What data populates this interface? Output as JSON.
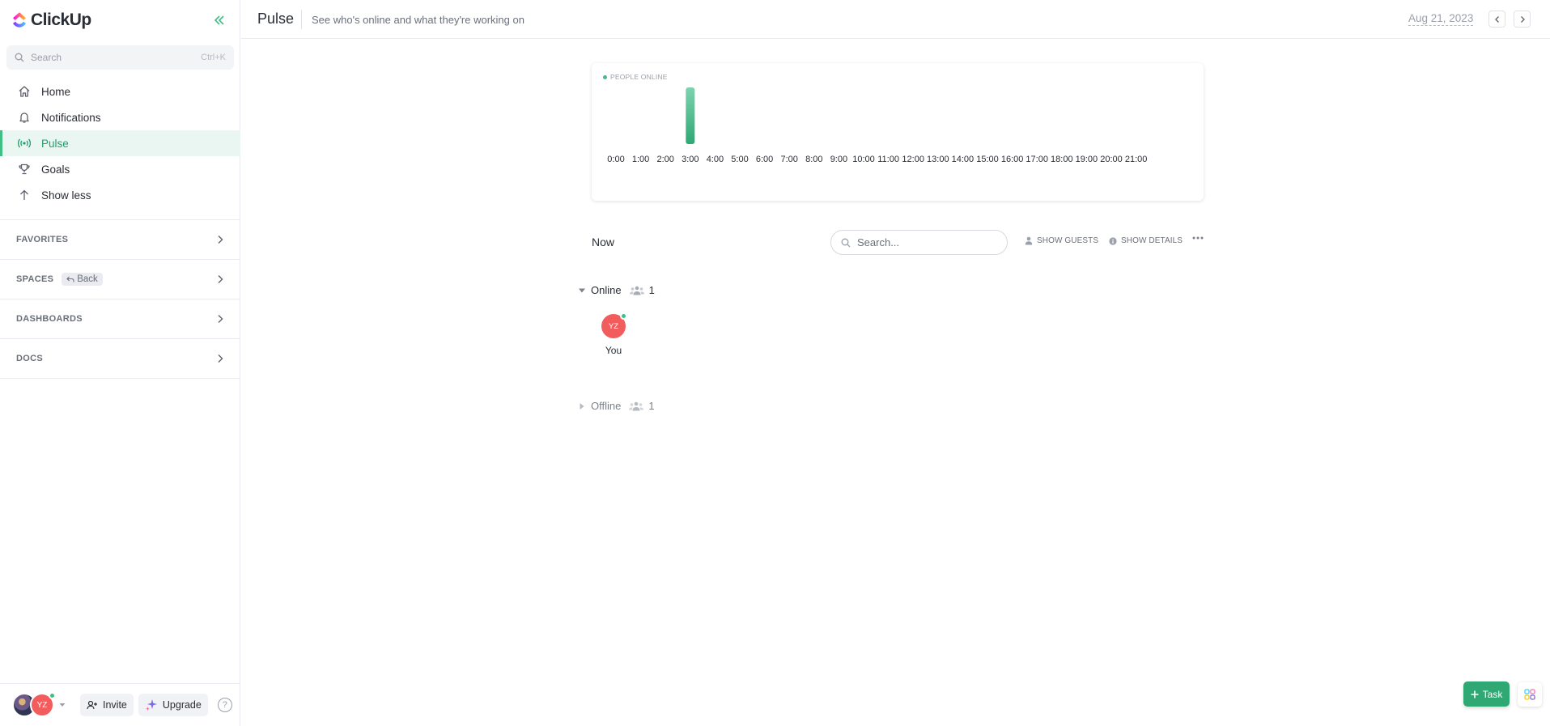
{
  "brand": {
    "name": "ClickUp"
  },
  "sidebar": {
    "search": {
      "placeholder": "Search",
      "shortcut": "Ctrl+K"
    },
    "nav": [
      {
        "label": "Home",
        "icon": "home-icon"
      },
      {
        "label": "Notifications",
        "icon": "bell-icon"
      },
      {
        "label": "Pulse",
        "icon": "pulse-icon",
        "active": true
      },
      {
        "label": "Goals",
        "icon": "trophy-icon"
      },
      {
        "label": "Show less",
        "icon": "arrow-up-icon"
      }
    ],
    "sections": {
      "favorites": "FAVORITES",
      "spaces": "SPACES",
      "back": "Back",
      "dashboards": "DASHBOARDS",
      "docs": "DOCS"
    },
    "footer": {
      "avatar_initials": "YZ",
      "invite": "Invite",
      "upgrade": "Upgrade",
      "help": "?"
    }
  },
  "header": {
    "title": "Pulse",
    "subtitle": "See who's online and what they're working on",
    "date": "Aug 21, 2023"
  },
  "chart_data": {
    "type": "bar",
    "legend": "PEOPLE ONLINE",
    "categories": [
      "0:00",
      "1:00",
      "2:00",
      "3:00",
      "4:00",
      "5:00",
      "6:00",
      "7:00",
      "8:00",
      "9:00",
      "10:00",
      "11:00",
      "12:00",
      "13:00",
      "14:00",
      "15:00",
      "16:00",
      "17:00",
      "18:00",
      "19:00",
      "20:00",
      "21:00"
    ],
    "values": [
      0,
      0,
      0,
      1,
      0,
      0,
      0,
      0,
      0,
      0,
      0,
      0,
      0,
      0,
      0,
      0,
      0,
      0,
      0,
      0,
      0,
      0
    ],
    "ylim": [
      0,
      1
    ],
    "grid": false,
    "bar_color": "#3fbf84"
  },
  "toolbar": {
    "now": "Now",
    "search_placeholder": "Search...",
    "show_guests": "SHOW GUESTS",
    "show_details": "SHOW DETAILS"
  },
  "groups": {
    "online": {
      "label": "Online",
      "count": "1",
      "users": [
        {
          "initials": "YZ",
          "name": "You"
        }
      ]
    },
    "offline": {
      "label": "Offline",
      "count": "1"
    }
  },
  "actions": {
    "task": "Task"
  },
  "colors": {
    "accent": "#3fbf84",
    "avatar": "#f25c5c"
  }
}
